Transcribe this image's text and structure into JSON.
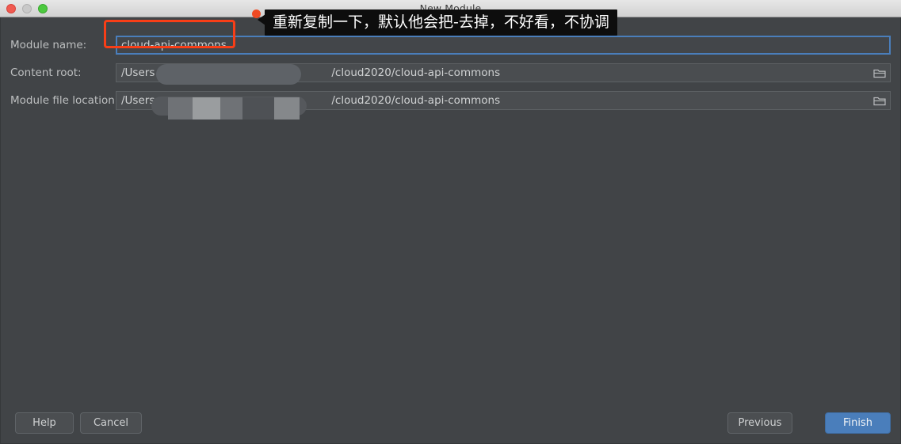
{
  "window": {
    "title": "New Module",
    "controls": {
      "close": "close-button",
      "minimize": "minimize-button",
      "zoom": "zoom-button"
    }
  },
  "form": {
    "fields": [
      {
        "label": "Module name:",
        "value": "cloud-api-commons",
        "focused": true,
        "has_browse": false
      },
      {
        "label": "Content root:",
        "value": "/Users",
        "value_suffix": "/cloud2020/cloud-api-commons",
        "focused": false,
        "has_browse": true,
        "browse_icon": "folder-icon"
      },
      {
        "label": "Module file location:",
        "value": "/Users",
        "value_suffix": "/cloud2020/cloud-api-commons",
        "focused": false,
        "has_browse": true,
        "browse_icon": "folder-icon"
      }
    ]
  },
  "buttons": {
    "help": "Help",
    "cancel": "Cancel",
    "previous": "Previous",
    "finish": "Finish"
  },
  "annotation": {
    "tooltip_text": "重新复制一下，默认他会把-去掉，不好看，不协调",
    "highlight_color": "#f83e17",
    "dot_color": "#ef4a23"
  },
  "colors": {
    "dialog_bg": "#414447",
    "field_bg": "#4a4d50",
    "focus_border": "#4a7ebb",
    "primary_button": "#4a7ebb",
    "text": "#cfd1d2",
    "label_text": "#bdbfc0"
  }
}
